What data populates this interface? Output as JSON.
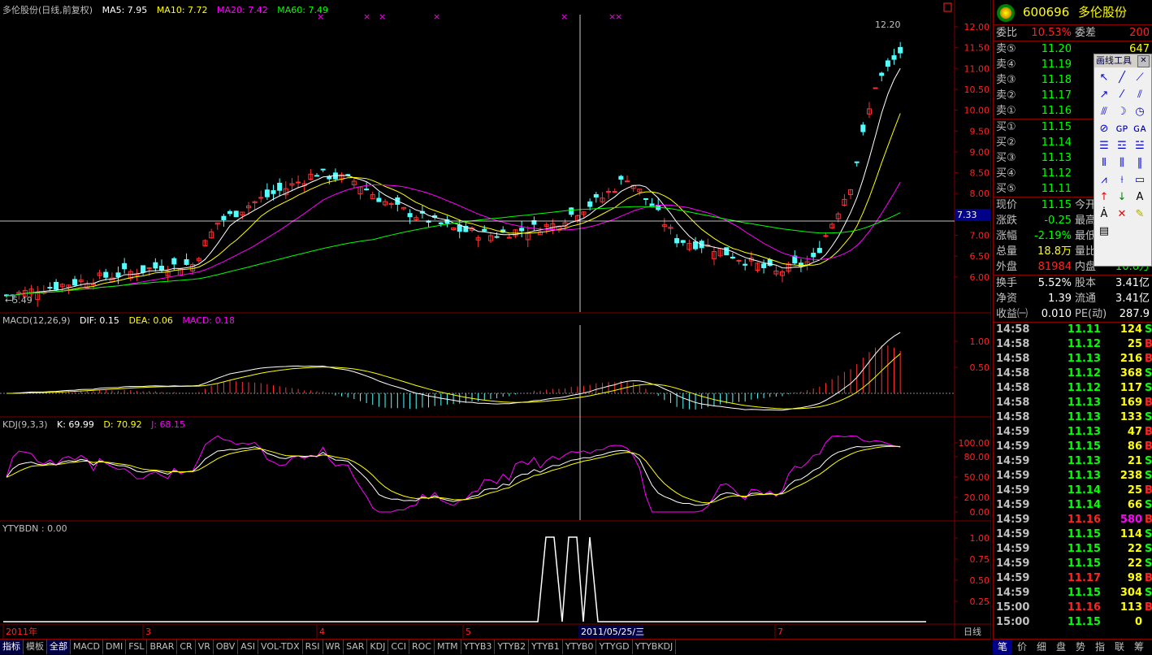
{
  "main_header": {
    "title": "多伦股份(日线,前复权)",
    "ma5": "MA5: 7.95",
    "ma10": "MA10: 7.72",
    "ma20": "MA20: 7.42",
    "ma60": "MA60: 7.49"
  },
  "macd_header": {
    "name": "MACD(12,26,9)",
    "dif": "DIF: 0.15",
    "dea": "DEA: 0.06",
    "macd": "MACD: 0.18"
  },
  "kdj_header": {
    "name": "KDJ(9,3,3)",
    "k": "K: 69.99",
    "d": "D: 70.92",
    "j": "J: 68.15"
  },
  "ytybdn_header": {
    "name": "YTYBDN : 0.00"
  },
  "price_annotations": {
    "high": "12.20",
    "low": "←5.49",
    "crosshair_price": "7.33"
  },
  "price_axis": [
    "12.00",
    "11.50",
    "11.00",
    "10.50",
    "10.00",
    "9.50",
    "9.00",
    "8.50",
    "8.00",
    "7.50",
    "7.00",
    "6.50",
    "6.00"
  ],
  "macd_axis": [
    "1.00",
    "0.50"
  ],
  "kdj_axis": [
    "100.00",
    "80.00",
    "50.00",
    "20.00",
    "0.00"
  ],
  "ytybdn_axis": [
    "1.00",
    "0.75",
    "0.50",
    "0.25"
  ],
  "time_axis": [
    "2011年",
    "3",
    "4",
    "5",
    "7"
  ],
  "crosshair_date": "2011/05/25/三",
  "period_label": "日线",
  "quote": {
    "code": "600696",
    "name": "多伦股份",
    "webi_label": "委比",
    "webi_value": "10.53%",
    "weicha_label": "委差",
    "weicha_value": "200",
    "sells": [
      {
        "label": "卖⑤",
        "price": "11.20",
        "vol": "647"
      },
      {
        "label": "卖④",
        "price": "11.19",
        "vol": ""
      },
      {
        "label": "卖③",
        "price": "11.18",
        "vol": ""
      },
      {
        "label": "卖②",
        "price": "11.17",
        "vol": ""
      },
      {
        "label": "卖①",
        "price": "11.16",
        "vol": ""
      }
    ],
    "buys": [
      {
        "label": "买①",
        "price": "11.15"
      },
      {
        "label": "买②",
        "price": "11.14"
      },
      {
        "label": "买③",
        "price": "11.13"
      },
      {
        "label": "买④",
        "price": "11.12"
      },
      {
        "label": "买⑤",
        "price": "11.11"
      }
    ],
    "xianjia_label": "现价",
    "xianjia_value": "11.15",
    "jinkai_label": "今开",
    "zhangdie_label": "涨跌",
    "zhangdie_value": "-0.25",
    "zuigao_label": "最高",
    "zhangfu_label": "涨幅",
    "zhangfu_value": "-2.19%",
    "zuidi_label": "最低",
    "zongliang_label": "总量",
    "zongliang_value": "18.8万",
    "liangbi_label": "量比",
    "waipan_label": "外盘",
    "waipan_value": "81984",
    "neipan_label": "内盘",
    "neipan_value": "10.6万",
    "huanshou_label": "换手",
    "huanshou_value": "5.52%",
    "guben_label": "股本",
    "guben_value": "3.41亿",
    "jingzi_label": "净资",
    "jingzi_value": "1.39",
    "liutong_label": "流通",
    "liutong_value": "3.41亿",
    "shouyi_label": "收益㈠",
    "shouyi_value": "0.010",
    "pe_label": "PE(动)",
    "pe_value": "287.9"
  },
  "ticks": [
    {
      "t": "14:58",
      "p": "11.11",
      "q": "124",
      "s": "S"
    },
    {
      "t": "14:58",
      "p": "11.12",
      "q": "25",
      "s": "B"
    },
    {
      "t": "14:58",
      "p": "11.13",
      "q": "216",
      "s": "B"
    },
    {
      "t": "14:58",
      "p": "11.12",
      "q": "368",
      "s": "S"
    },
    {
      "t": "14:58",
      "p": "11.12",
      "q": "117",
      "s": "S"
    },
    {
      "t": "14:58",
      "p": "11.13",
      "q": "169",
      "s": "B"
    },
    {
      "t": "14:58",
      "p": "11.13",
      "q": "133",
      "s": "S"
    },
    {
      "t": "14:59",
      "p": "11.13",
      "q": "47",
      "s": "B"
    },
    {
      "t": "14:59",
      "p": "11.15",
      "q": "86",
      "s": "B"
    },
    {
      "t": "14:59",
      "p": "11.13",
      "q": "21",
      "s": "S"
    },
    {
      "t": "14:59",
      "p": "11.13",
      "q": "238",
      "s": "S"
    },
    {
      "t": "14:59",
      "p": "11.14",
      "q": "25",
      "s": "B"
    },
    {
      "t": "14:59",
      "p": "11.14",
      "q": "66",
      "s": "S"
    },
    {
      "t": "14:59",
      "p": "11.16",
      "q": "580",
      "s": "B"
    },
    {
      "t": "14:59",
      "p": "11.15",
      "q": "114",
      "s": "S"
    },
    {
      "t": "14:59",
      "p": "11.15",
      "q": "22",
      "s": "S"
    },
    {
      "t": "14:59",
      "p": "11.15",
      "q": "22",
      "s": "S"
    },
    {
      "t": "14:59",
      "p": "11.17",
      "q": "98",
      "s": "B"
    },
    {
      "t": "14:59",
      "p": "11.15",
      "q": "304",
      "s": "S"
    },
    {
      "t": "15:00",
      "p": "11.16",
      "q": "113",
      "s": "B"
    },
    {
      "t": "15:00",
      "p": "11.15",
      "q": "0",
      "s": ""
    }
  ],
  "tools_title": "画线工具",
  "tabs": [
    "指标",
    "模板",
    "全部",
    "MACD",
    "DMI",
    "FSL",
    "BRAR",
    "CR",
    "VR",
    "OBV",
    "ASI",
    "VOL-TDX",
    "RSI",
    "WR",
    "SAR",
    "KDJ",
    "CCI",
    "ROC",
    "MTM",
    "YTYB3",
    "YTYB2",
    "YTYB1",
    "YTYB0",
    "YTYGD",
    "YTYBKDJ"
  ],
  "quote_tabs": [
    "笔",
    "价",
    "细",
    "盘",
    "势",
    "指",
    "联",
    "筹"
  ],
  "colors": {
    "up": "#ff3232",
    "down": "#54ffff",
    "ma5": "#ffffff",
    "ma10": "#ffff00",
    "ma20": "#ff00ff",
    "ma60": "#00ff00",
    "grid": "#800000"
  }
}
